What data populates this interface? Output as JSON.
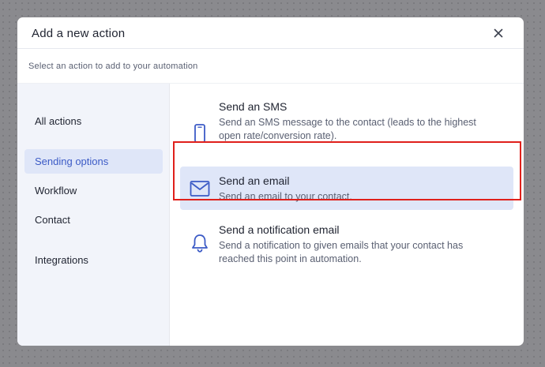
{
  "modal": {
    "title": "Add a new action",
    "subtitle": "Select an action to add to your automation"
  },
  "sidebar": {
    "items": [
      {
        "label": "All actions",
        "active": false
      },
      {
        "label": "Sending options",
        "active": true
      },
      {
        "label": "Workflow",
        "active": false
      },
      {
        "label": "Contact",
        "active": false
      },
      {
        "label": "Integrations",
        "active": false
      }
    ]
  },
  "options": [
    {
      "icon": "phone-icon",
      "title": "Send an SMS",
      "description": "Send an SMS message to the contact (leads to the highest open rate/conversion rate).",
      "selected": false
    },
    {
      "icon": "envelope-icon",
      "title": "Send an email",
      "description": "Send an email to your contact.",
      "selected": true
    },
    {
      "icon": "bell-icon",
      "title": "Send a notification email",
      "description": "Send a notification to given emails that your contact has reached this point in automation.",
      "selected": false
    }
  ],
  "colors": {
    "accent": "#3c5bc6",
    "selected_bg": "#dfe6f8",
    "highlight_border": "#e0201b"
  }
}
